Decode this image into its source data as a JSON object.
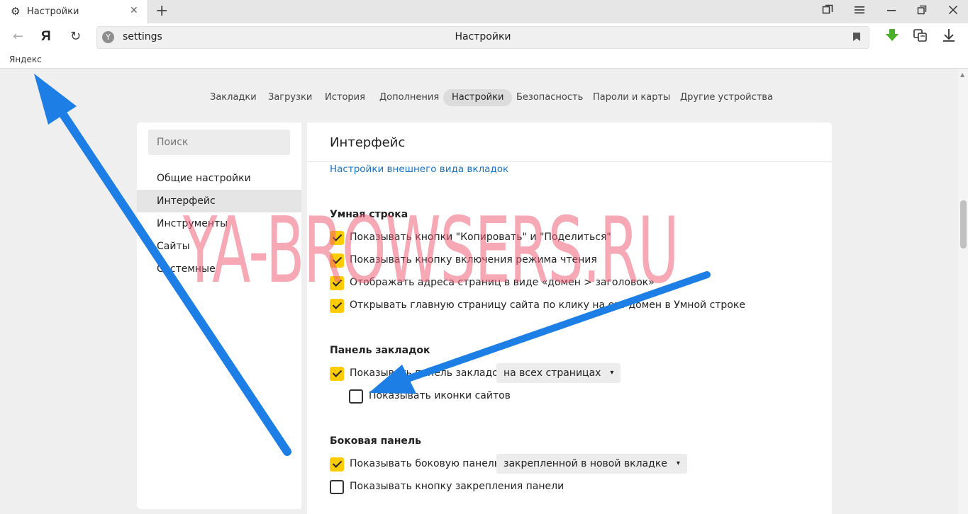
{
  "browser": {
    "tab_title": "Настройки",
    "tab_icon": "gear-icon",
    "new_tab_label": "+",
    "address": "settings",
    "page_title": "Настройки",
    "yandex_logo": "Я",
    "bookmark_label": "Яндекс"
  },
  "settings_nav": [
    "Закладки",
    "Загрузки",
    "История",
    "Дополнения",
    "Настройки",
    "Безопасность",
    "Пароли и карты",
    "Другие устройства"
  ],
  "sidebar": {
    "search_placeholder": "Поиск",
    "items": [
      "Общие настройки",
      "Интерфейс",
      "Инструменты",
      "Сайты",
      "Системные"
    ]
  },
  "main": {
    "header": "Интерфейс",
    "tabs_link": "Настройки внешнего вида вкладок",
    "smart_line": {
      "title": "Умная строка",
      "options": [
        {
          "label": "Показывать кнопки \"Копировать\" и \"Поделиться\"",
          "checked": true
        },
        {
          "label": "Показывать кнопку включения режима чтения",
          "checked": true
        },
        {
          "label": "Отображать адреса страниц в виде «домен > заголовок»",
          "checked": true
        },
        {
          "label": "Открывать главную страницу сайта по клику на его домен в Умной строке",
          "checked": true
        }
      ]
    },
    "bookmarks_panel": {
      "title": "Панель закладок",
      "show_label": "Показывать панель закладок",
      "show_checked": true,
      "show_dropdown": "на всех страницах",
      "icons_label": "Показывать иконки сайтов",
      "icons_checked": false
    },
    "side_panel": {
      "title": "Боковая панель",
      "show_label": "Показывать боковую панель",
      "show_checked": true,
      "show_dropdown": "закрепленной в новой вкладке",
      "pin_label": "Показывать кнопку закрепления панели",
      "pin_checked": false
    }
  },
  "watermark": "YA-BROWSERS.RU",
  "colors": {
    "checkbox_on": "#ffcc00",
    "link": "#1a73c7",
    "arrow": "#1d7fe6",
    "watermark": "#f06078"
  }
}
